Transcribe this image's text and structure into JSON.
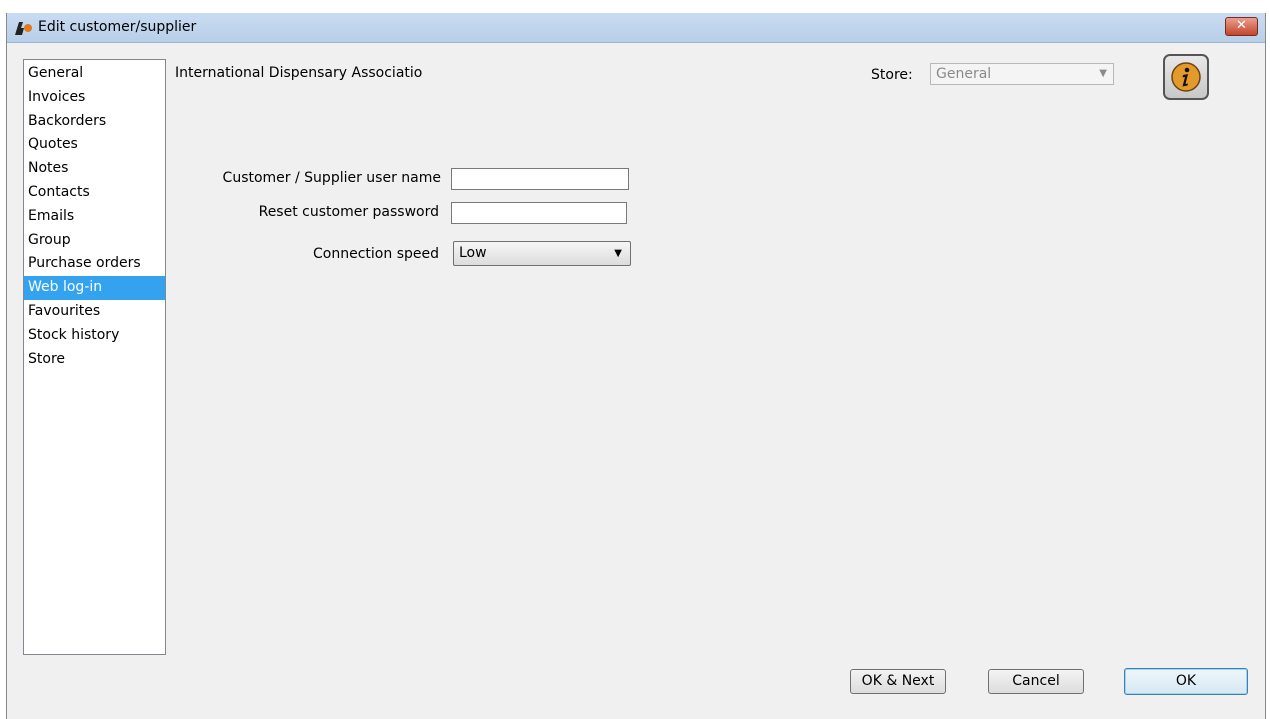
{
  "window": {
    "title": "Edit customer/supplier",
    "close_label": "✕"
  },
  "sidebar": {
    "items": [
      {
        "label": "General"
      },
      {
        "label": "Invoices"
      },
      {
        "label": "Backorders"
      },
      {
        "label": "Quotes"
      },
      {
        "label": "Notes"
      },
      {
        "label": "Contacts"
      },
      {
        "label": "Emails"
      },
      {
        "label": "Group"
      },
      {
        "label": "Purchase orders"
      },
      {
        "label": "Web log-in"
      },
      {
        "label": "Favourites"
      },
      {
        "label": "Stock history"
      },
      {
        "label": "Store"
      }
    ],
    "selected": "Web log-in"
  },
  "header": {
    "customer_name": "International Dispensary Associatio",
    "store_label": "Store:",
    "store_value": "General"
  },
  "form": {
    "username_label": "Customer / Supplier user name",
    "username_value": "",
    "password_label": "Reset customer password",
    "password_value": "",
    "speed_label": "Connection speed",
    "speed_value": "Low"
  },
  "buttons": {
    "ok_next": "OK & Next",
    "cancel": "Cancel",
    "ok": "OK"
  },
  "colors": {
    "selected_bg": "#33a3ef",
    "window_bg": "#f0f0f0",
    "info_icon": "#e39a2d"
  }
}
